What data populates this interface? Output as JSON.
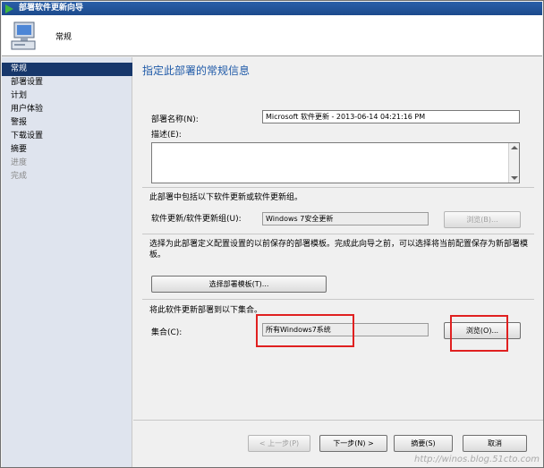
{
  "window": {
    "title": "部署软件更新向导"
  },
  "header": {
    "title": "常规"
  },
  "nav": {
    "items": [
      {
        "label": "常规",
        "state": "active"
      },
      {
        "label": "部署设置",
        "state": "normal"
      },
      {
        "label": "计划",
        "state": "normal"
      },
      {
        "label": "用户体验",
        "state": "normal"
      },
      {
        "label": "警报",
        "state": "normal"
      },
      {
        "label": "下载设置",
        "state": "normal"
      },
      {
        "label": "摘要",
        "state": "normal"
      },
      {
        "label": "进度",
        "state": "disabled"
      },
      {
        "label": "完成",
        "state": "disabled"
      }
    ]
  },
  "main": {
    "page_title": "指定此部署的常规信息",
    "deployment_name_label": "部署名称(N):",
    "deployment_name_value": "Microsoft 软件更新 - 2013-06-14 04:21:16 PM",
    "description_label": "描述(E):",
    "description_value": "",
    "includes_text": "此部署中包括以下软件更新或软件更新组。",
    "update_group_label": "软件更新/软件更新组(U):",
    "update_group_value": "Windows 7安全更新",
    "update_browse_label": "浏览(B)...",
    "template_text": "选择为此部署定义配置设置的以前保存的部署模板。完成此向导之前，可以选择将当前配置保存为新部署模板。",
    "template_button_label": "选择部署模板(T)...",
    "collection_intro": "将此软件更新部署到以下集合。",
    "collection_label": "集合(C):",
    "collection_value": "所有Windows7系统",
    "collection_browse_label": "浏览(O)..."
  },
  "footer": {
    "prev_label": "< 上一步(P)",
    "next_label": "下一步(N) >",
    "summary_label": "摘要(S)",
    "cancel_label": "取消"
  },
  "watermark": "http://winos.blog.51cto.com",
  "colors": {
    "title_bar": "#1c4a8c",
    "nav_active": "#17376b",
    "nav_background": "#dfe4ee",
    "page_title": "#1f5aa8",
    "highlight_box": "#e02020"
  }
}
